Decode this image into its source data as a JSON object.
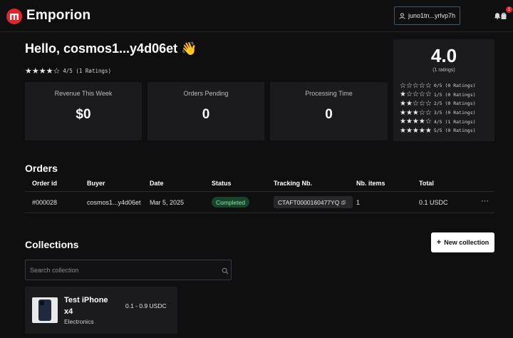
{
  "header": {
    "brand": "Emporion",
    "wallet_label": "juno1tn...yrlvp7h",
    "cart_badge": "1"
  },
  "seller": {
    "greeting": "Hello, cosmos1...y4d06et 👋",
    "rating_summary": "4/5 (1 Ratings)",
    "rating_stars": "★★★★☆"
  },
  "stats": [
    {
      "label": "Revenue This Week",
      "value": "$0"
    },
    {
      "label": "Orders Pending",
      "value": "0"
    },
    {
      "label": "Processing Time",
      "value": "0"
    }
  ],
  "ratings_panel": {
    "average": "4.0",
    "count": "(1 ratings)",
    "rows": [
      {
        "stars": "☆☆☆☆☆",
        "text": "0/5 (0 Ratings)"
      },
      {
        "stars": "★☆☆☆☆",
        "text": "1/5 (0 Ratings)"
      },
      {
        "stars": "★★☆☆☆",
        "text": "2/5 (0 Ratings)"
      },
      {
        "stars": "★★★☆☆",
        "text": "3/5 (0 Ratings)"
      },
      {
        "stars": "★★★★☆",
        "text": "4/5 (1 Ratings)"
      },
      {
        "stars": "★★★★★",
        "text": "5/5 (0 Ratings)"
      }
    ]
  },
  "orders": {
    "title": "Orders",
    "columns": [
      "Order id",
      "Buyer",
      "Date",
      "Status",
      "Tracking Nb.",
      "Nb. items",
      "Total"
    ],
    "rows": [
      {
        "order_id": "#000028",
        "buyer": "cosmos1...y4d06et",
        "date": "Mar 5, 2025",
        "status": "Completed",
        "tracking": "CTAFT0000160477YQ",
        "items": "1",
        "total": "0.1 USDC",
        "menu": "···"
      }
    ]
  },
  "collections": {
    "title": "Collections",
    "new_button": "New collection",
    "new_button_icon": "+",
    "search_placeholder": "Search collection",
    "items": [
      {
        "name": "Test iPhone x4",
        "category": "Electronics",
        "price": "0.1 - 0.9 USDC"
      }
    ]
  },
  "colors": {
    "accent": "#e0262c",
    "status_bg": "#17452b",
    "status_text": "#8ee0a9",
    "card_bg": "#1b1b1d",
    "page_bg": "#0f0f10"
  },
  "icons": [
    "emporion-logo-icon",
    "user-icon",
    "bell-icon",
    "cart-icon",
    "copy-icon",
    "search-icon",
    "more-icon",
    "plus-icon"
  ]
}
